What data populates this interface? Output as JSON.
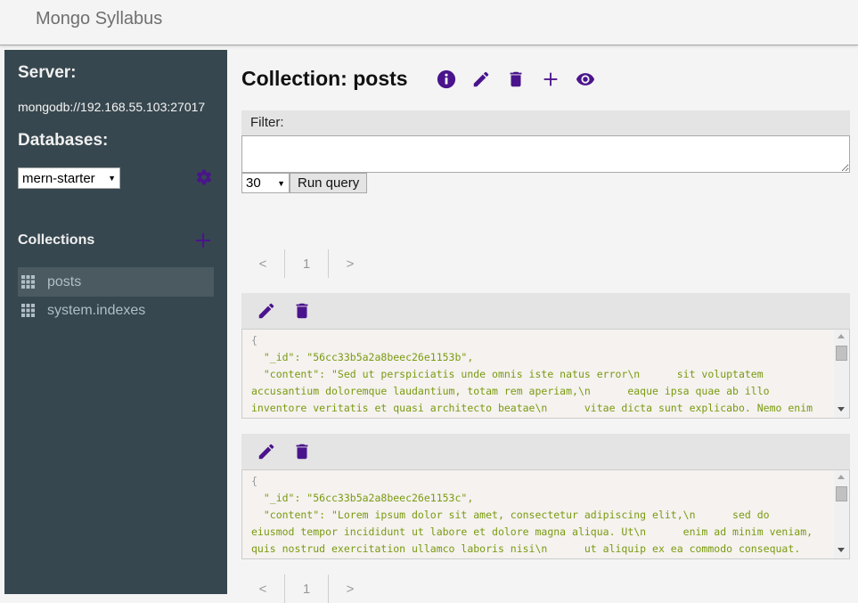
{
  "app": {
    "title": "Mongo Syllabus"
  },
  "sidebar": {
    "server_heading": "Server:",
    "server_url": "mongodb://192.168.55.103:27017",
    "databases_heading": "Databases:",
    "database_selected": "mern-starter",
    "collections_heading": "Collections",
    "collections": [
      {
        "name": "posts",
        "active": true
      },
      {
        "name": "system.indexes",
        "active": false
      }
    ],
    "icons": {
      "settings": "gear-icon",
      "add_collection": "plus-icon",
      "collection": "grid-icon"
    }
  },
  "main": {
    "title": "Collection: posts",
    "toolbar_icons": [
      "info-icon",
      "pencil-icon",
      "trash-icon",
      "plus-icon",
      "eye-icon"
    ],
    "filter": {
      "label": "Filter:",
      "value": "",
      "placeholder": ""
    },
    "limit_selected": "30",
    "run_query_label": "Run query",
    "pager": {
      "prev": "<",
      "page": "1",
      "next": ">"
    },
    "documents": [
      {
        "lines": [
          "{",
          "  \"_id\": \"56cc33b5a2a8beec26e1153b\",",
          "  \"content\": \"Sed ut perspiciatis unde omnis iste natus error\\n      sit voluptatem",
          "accusantium doloremque laudantium, totam rem aperiam,\\n      eaque ipsa quae ab illo",
          "inventore veritatis et quasi architecto beatae\\n      vitae dicta sunt explicabo. Nemo enim"
        ]
      },
      {
        "lines": [
          "{",
          "  \"_id\": \"56cc33b5a2a8beec26e1153c\",",
          "  \"content\": \"Lorem ipsum dolor sit amet, consectetur adipiscing elit,\\n      sed do",
          "eiusmod tempor incididunt ut labore et dolore magna aliqua. Ut\\n      enim ad minim veniam,",
          "quis nostrud exercitation ullamco laboris nisi\\n      ut aliquip ex ea commodo consequat."
        ]
      }
    ]
  },
  "colors": {
    "accent": "#4a148c",
    "sidebar_bg": "#37474f",
    "sidebar_active": "#4b5a61",
    "json_text": "#7a9a10",
    "page_bg": "#f4f4f4"
  }
}
